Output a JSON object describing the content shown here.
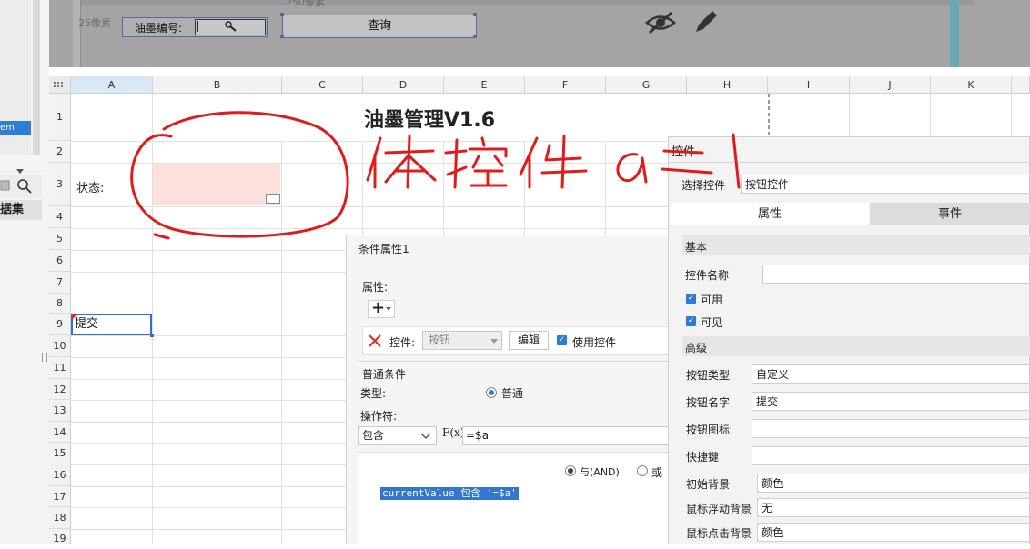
{
  "sidebar": {
    "item_text": "em",
    "data_label": "据集"
  },
  "form_design": {
    "px25_label": "25像素",
    "px250_label": "250像素",
    "field_label": "油墨编号:",
    "query_label": "查询"
  },
  "columns": [
    "A",
    "B",
    "C",
    "D",
    "E",
    "F",
    "G",
    "H",
    "I",
    "J",
    "K"
  ],
  "rows": [
    "1",
    "2",
    "3",
    "4",
    "5",
    "6",
    "7",
    "8",
    "9",
    "10",
    "11",
    "12",
    "13",
    "14",
    "15",
    "16",
    "17",
    "18",
    "19"
  ],
  "cells": {
    "title": "油墨管理V1.6",
    "status_label": "状态:",
    "submit": "提交"
  },
  "annotation": {
    "handwritten_text": "体控件 a = 1"
  },
  "condition_dialog": {
    "title": "条件属性1",
    "attr_label": "属性:",
    "add_symbol": "+",
    "control_label": "控件:",
    "control_value": "按钮",
    "edit_label": "编辑",
    "use_control_label": "使用控件",
    "normal_cond_label": "普通条件",
    "type_label": "类型:",
    "type_value": "普通",
    "operator_label": "操作符:",
    "operator_value": "包含",
    "fx_label": "F(x)",
    "formula_value": "=$a",
    "and_label": "与(AND)",
    "or_label": "或",
    "expression": "currentValue 包含 '=$a'"
  },
  "control_panel": {
    "title": "控件",
    "select_label": "选择控件",
    "select_value": "按钮控件",
    "tab_props": "属性",
    "tab_events": "事件",
    "basic_label": "基本",
    "name_label": "控件名称",
    "name_value": "",
    "enabled_label": "可用",
    "visible_label": "可见",
    "advanced_label": "高级",
    "btn_type_label": "按钮类型",
    "btn_type_value": "自定义",
    "btn_name_label": "按钮名字",
    "btn_name_value": "提交",
    "btn_icon_label": "按钮图标",
    "btn_icon_value": "",
    "shortcut_label": "快捷键",
    "shortcut_value": "",
    "init_bg_label": "初始背景",
    "init_bg_value": "颜色",
    "hover_bg_label": "鼠标浮动背景",
    "hover_bg_value": "无",
    "click_bg_label": "鼠标点击背景",
    "click_bg_value": "颜色"
  },
  "colors": {
    "accent": "#2e7bd6",
    "annotation_red": "#e01b1b",
    "selection_pink": "#fde0dc"
  }
}
